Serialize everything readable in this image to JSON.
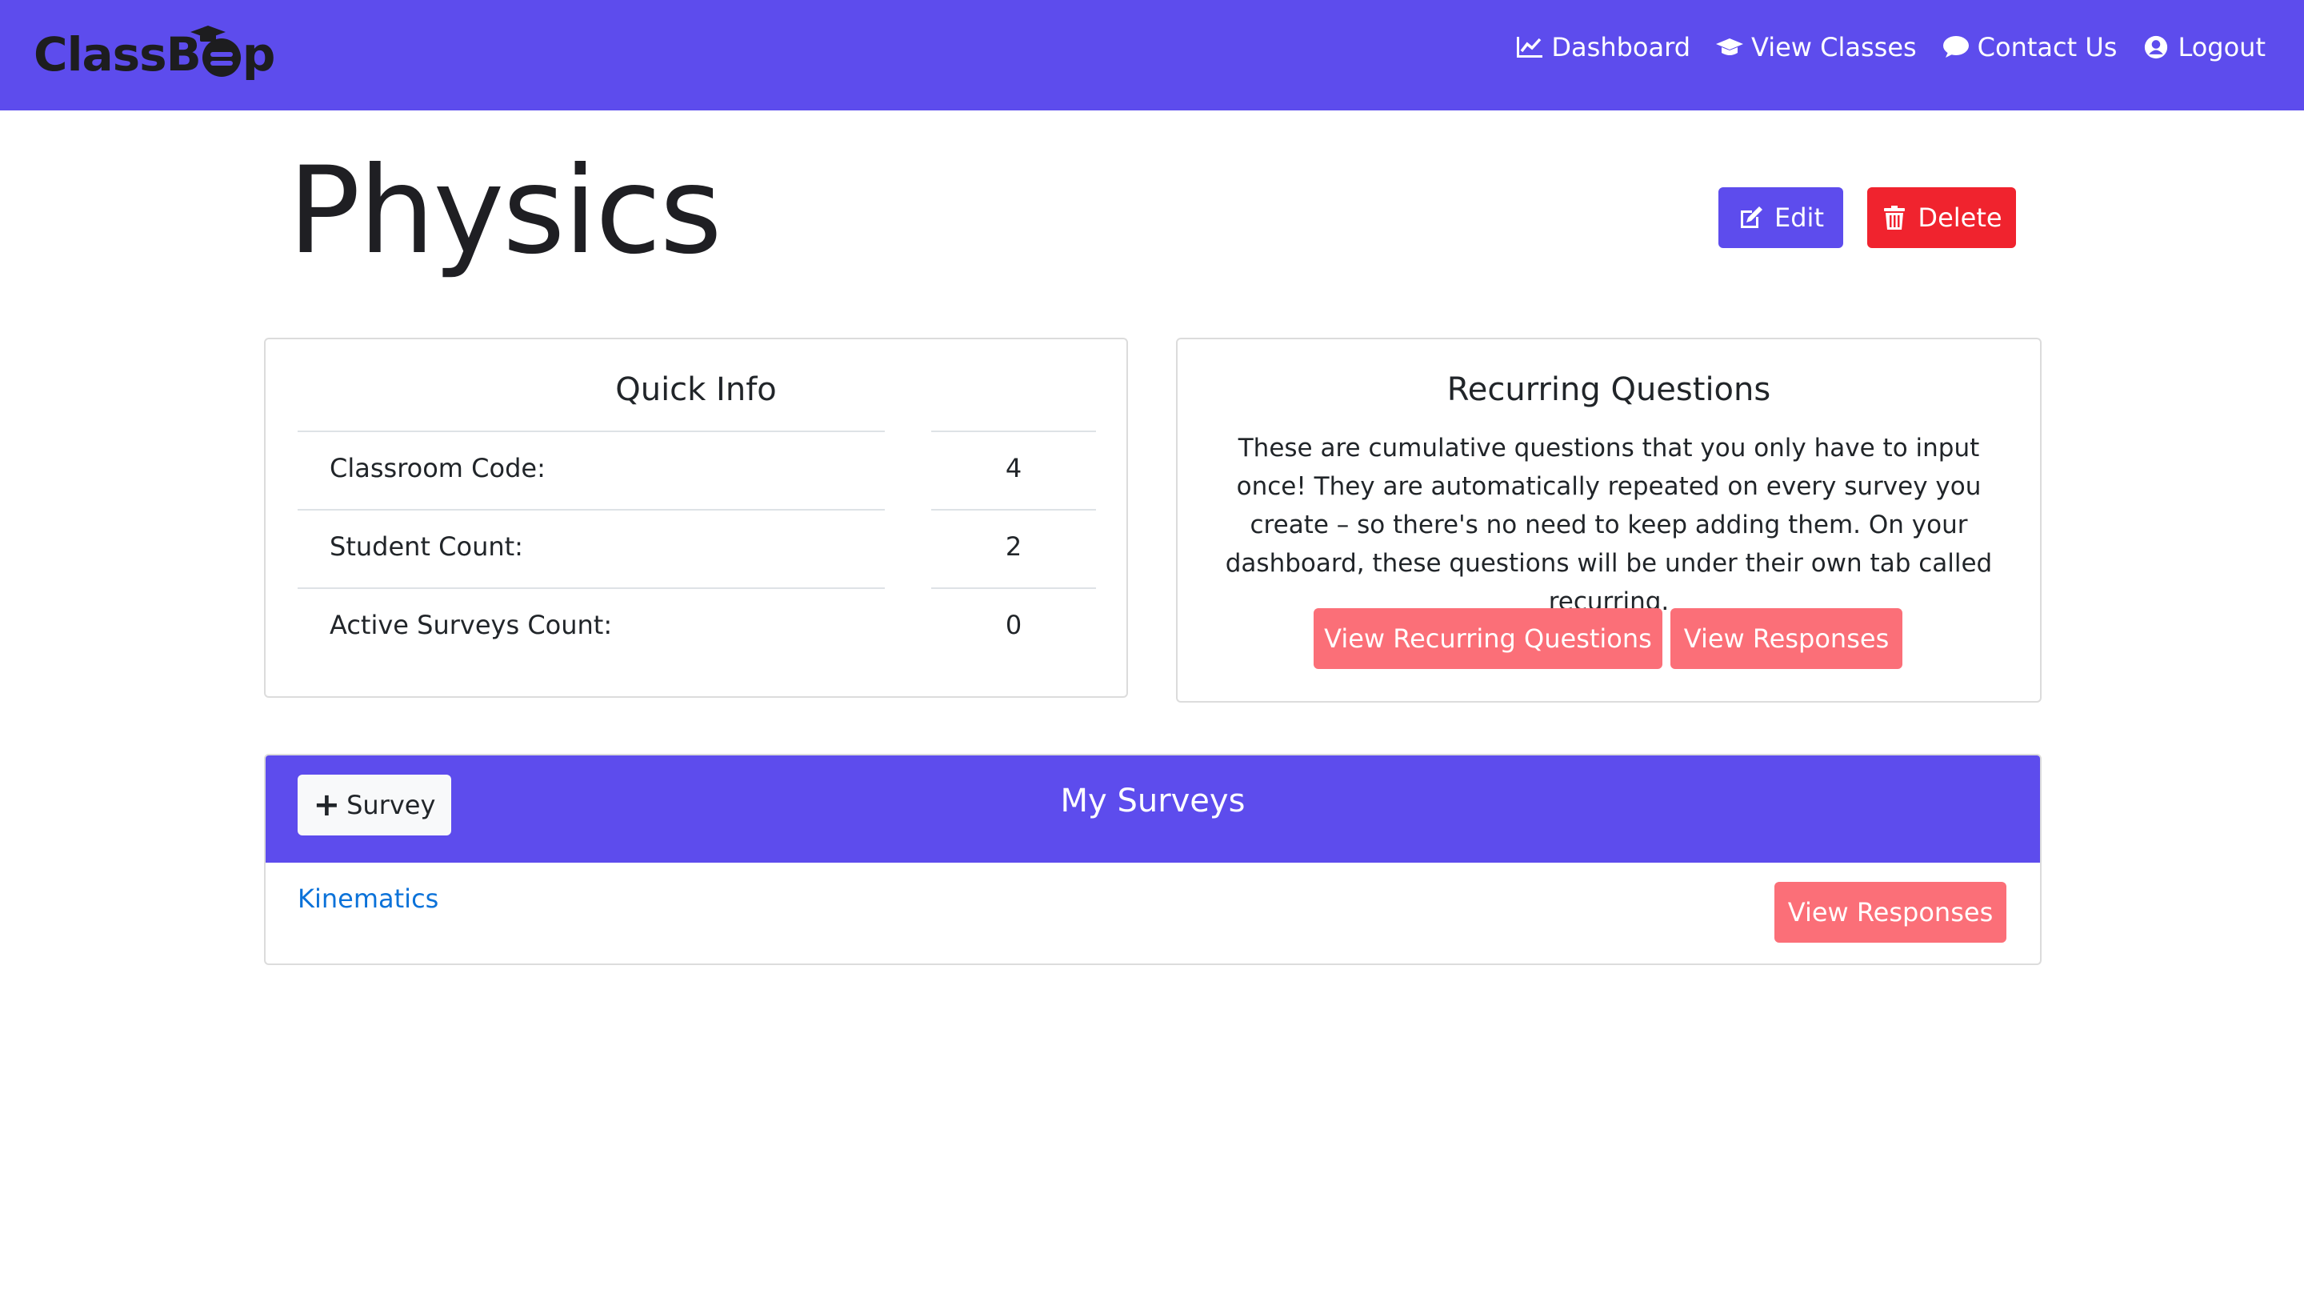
{
  "brand": {
    "name_start": "Class",
    "name_end": "p"
  },
  "nav": {
    "dashboard": "Dashboard",
    "view_classes": "View Classes",
    "contact_us": "Contact Us",
    "logout": "Logout"
  },
  "page": {
    "title": "Physics"
  },
  "actions": {
    "edit": "Edit",
    "delete": "Delete"
  },
  "quick_info": {
    "title": "Quick Info",
    "rows": [
      {
        "label": "Classroom Code:",
        "value": "4"
      },
      {
        "label": "Student Count:",
        "value": "2"
      },
      {
        "label": "Active Surveys Count:",
        "value": "0"
      }
    ]
  },
  "recurring": {
    "title": "Recurring Questions",
    "description": "These are cumulative questions that you only have to input once! They are automatically repeated on every survey you create – so there's no need to keep adding them. On your dashboard, these questions will be under their own tab called recurring.",
    "view_questions": "View Recurring Questions",
    "view_responses": "View Responses"
  },
  "surveys": {
    "title": "My Surveys",
    "add_label": "Survey",
    "items": [
      {
        "name": "Kinematics",
        "action": "View Responses"
      }
    ]
  },
  "colors": {
    "primary": "#5d4ced",
    "danger": "#f0232e",
    "pink": "#fb6f78",
    "link": "#0b72d9"
  }
}
